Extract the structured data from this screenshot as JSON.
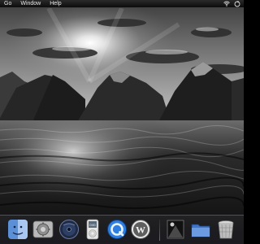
{
  "menubar": {
    "items": [
      "Go",
      "Window",
      "Help"
    ],
    "status_icons": [
      "wifi-icon",
      "sync-icon"
    ]
  },
  "desktop": {
    "wallpaper": "grayscale-mountain-lake-sunset"
  },
  "dock": {
    "apps": [
      {
        "name": "finder-icon"
      },
      {
        "name": "system-preferences-icon"
      },
      {
        "name": "dvd-player-icon"
      },
      {
        "name": "ipod-icon"
      },
      {
        "name": "quicktime-icon"
      },
      {
        "name": "wordpress-icon"
      },
      {
        "name": "image-viewer-icon"
      },
      {
        "name": "folder-icon"
      },
      {
        "name": "trash-icon"
      }
    ]
  },
  "colors": {
    "menubar_bg": "#1a1a1a",
    "menubar_text": "#e8e8e8",
    "finder_blue": "#5b8fd6",
    "quicktime_blue": "#2f7fe0",
    "folder_blue": "#3f74c6"
  }
}
